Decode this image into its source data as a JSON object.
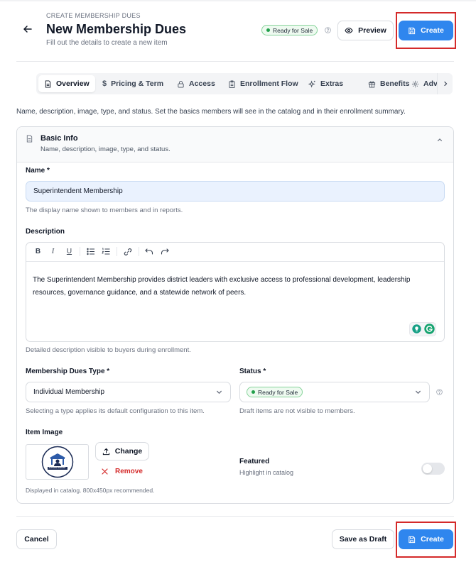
{
  "header": {
    "eyebrow": "CREATE MEMBERSHIP DUES",
    "title": "New Membership Dues",
    "subtitle": "Fill out the details to create a new item",
    "status_badge": "Ready for Sale",
    "preview_label": "Preview",
    "create_label": "Create"
  },
  "tabs": [
    {
      "label": "Overview",
      "icon": "document-icon",
      "active": true
    },
    {
      "label": "Pricing & Term",
      "icon": "dollar-icon"
    },
    {
      "label": "Access",
      "icon": "lock-icon"
    },
    {
      "label": "Enrollment Flow",
      "icon": "clipboard-icon"
    },
    {
      "label": "Extras",
      "icon": "sparkles-icon"
    },
    {
      "label": "Benefits",
      "icon": "gift-icon"
    },
    {
      "label": "Adv",
      "icon": "gear-icon"
    }
  ],
  "intro_text": "Name, description, image, type, and status. Set the basics members will see in the catalog and in their enrollment summary.",
  "section": {
    "title": "Basic Info",
    "subtitle": "Name, description, image, type, and status."
  },
  "form": {
    "name_label": "Name *",
    "name_value": "Superintendent Membership",
    "name_hint": "The display name shown to members and in reports.",
    "description_label": "Description",
    "description_value": "The Superintendent Membership provides district leaders with exclusive access to professional development, leadership resources, governance guidance, and a statewide network of peers.",
    "description_hint": "Detailed description visible to buyers during enrollment.",
    "type_label": "Membership Dues Type *",
    "type_value": "Individual Membership",
    "type_hint": "Selecting a type applies its default configuration to this item.",
    "status_label": "Status *",
    "status_value": "Ready for Sale",
    "status_hint": "Draft items are not visible to members.",
    "image_label": "Item Image",
    "image_logo_text": "SUPERINTENDENT",
    "change_label": "Change",
    "remove_label": "Remove",
    "image_hint": "Displayed in catalog. 800x450px recommended.",
    "featured_label": "Featured",
    "featured_hint": "Highlight in catalog",
    "featured_on": false
  },
  "footer": {
    "cancel_label": "Cancel",
    "draft_label": "Save as Draft",
    "create_label": "Create"
  },
  "colors": {
    "primary": "#2f86ee",
    "success": "#22a04b",
    "danger": "#d42a2a",
    "highlight_border": "#d42a2a"
  }
}
